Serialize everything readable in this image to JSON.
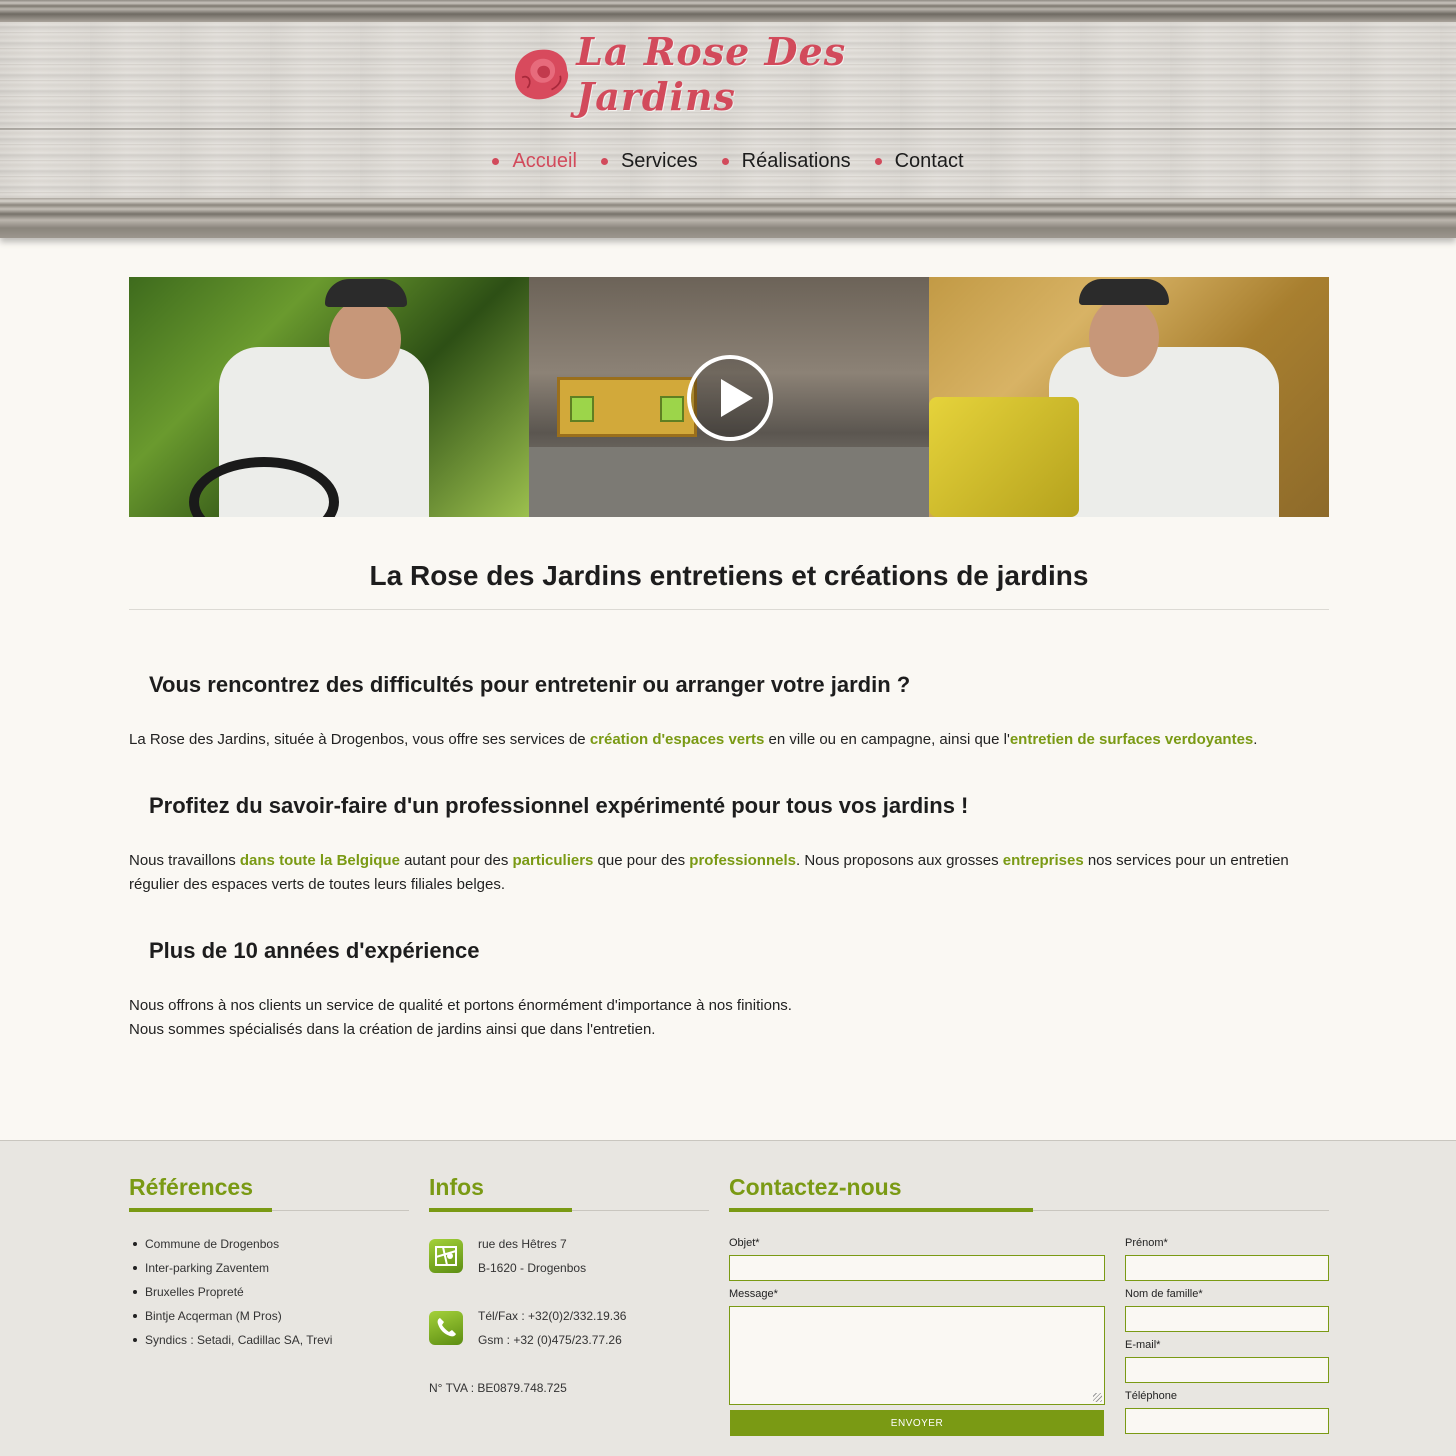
{
  "brand": {
    "name": "La Rose Des Jardins",
    "accent_color": "#d24a5b",
    "green_color": "#7a9a14"
  },
  "nav": {
    "items": [
      {
        "label": "Accueil",
        "active": true
      },
      {
        "label": "Services",
        "active": false
      },
      {
        "label": "Réalisations",
        "active": false
      },
      {
        "label": "Contact",
        "active": false
      }
    ]
  },
  "banner": {
    "video_icon": "play-icon"
  },
  "main": {
    "title": "La Rose des Jardins entretiens et créations de jardins",
    "sections": [
      {
        "heading": "Vous rencontrez des difficultés pour entretenir ou arranger votre jardin ?",
        "p1": "La Rose des Jardins, située à Drogenbos, vous offre ses services de ",
        "l1": "création d'espaces verts",
        "p2": " en ville ou en campagne, ainsi que l'",
        "l2": "entretien de surfaces verdoyantes",
        "p3": "."
      },
      {
        "heading": "Profitez du savoir-faire d'un professionnel expérimenté pour tous vos jardins !",
        "p1": "Nous travaillons ",
        "l1": "dans toute la Belgique",
        "p2": " autant pour des ",
        "l2": "particuliers",
        "p3": " que pour des ",
        "l3": "professionnels",
        "p4": ". Nous proposons aux grosses ",
        "l4": "entreprises",
        "p5": " nos services pour un entretien régulier des espaces verts de toutes leurs filiales belges."
      },
      {
        "heading": "Plus de 10 années d'expérience",
        "line1": "Nous offrons à nos clients un service de qualité et portons énormément d'importance à nos finitions.",
        "line2": "Nous sommes spécialisés dans la création de jardins ainsi que dans l'entretien."
      }
    ]
  },
  "footer": {
    "references": {
      "title": "Références",
      "items": [
        "Commune de Drogenbos",
        "Inter-parking Zaventem",
        "Bruxelles Propreté",
        "Bintje Acqerman (M Pros)",
        "Syndics : Setadi, Cadillac SA, Trevi"
      ]
    },
    "infos": {
      "title": "Infos",
      "address_line1": "rue des Hêtres 7",
      "address_line2": "B-1620 - Drogenbos",
      "phone": "Tél/Fax : +32(0)2/332.19.36",
      "gsm": "Gsm : +32 (0)475/23.77.26",
      "vat": "N° TVA : BE0879.748.725"
    },
    "contact": {
      "title": "Contactez-nous",
      "objet_label": "Objet*",
      "message_label": "Message*",
      "prenom_label": "Prénom*",
      "nom_label": "Nom de famille*",
      "email_label": "E-mail*",
      "tel_label": "Téléphone",
      "send_label": "ENVOYER"
    }
  }
}
